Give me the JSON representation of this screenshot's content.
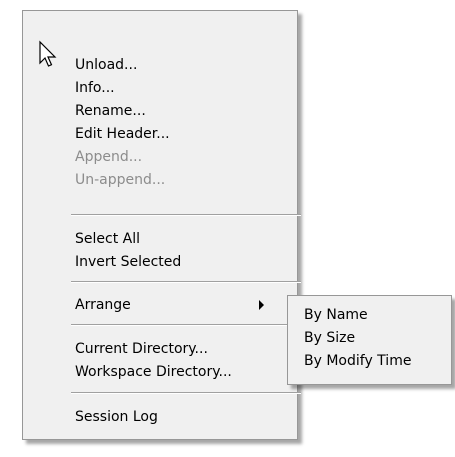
{
  "menu": {
    "items": [
      {
        "label": "Unload..."
      },
      {
        "label": "Info..."
      },
      {
        "label": "Rename..."
      },
      {
        "label": "Edit Header..."
      },
      {
        "label": "Append...",
        "disabled": true
      },
      {
        "label": "Un-append...",
        "disabled": true
      },
      {
        "label": "Select All"
      },
      {
        "label": "Invert Selected"
      },
      {
        "label": "Arrange",
        "has_submenu": true
      },
      {
        "label": "Current Directory..."
      },
      {
        "label": "Workspace Directory..."
      },
      {
        "label": "Session Log"
      }
    ]
  },
  "submenu": {
    "items": [
      {
        "label": "By Name"
      },
      {
        "label": "By Size"
      },
      {
        "label": "By Modify Time"
      }
    ]
  },
  "icons": {
    "cursor": "arrow-cursor-icon",
    "submenu_arrow": "chevron-right-icon"
  }
}
